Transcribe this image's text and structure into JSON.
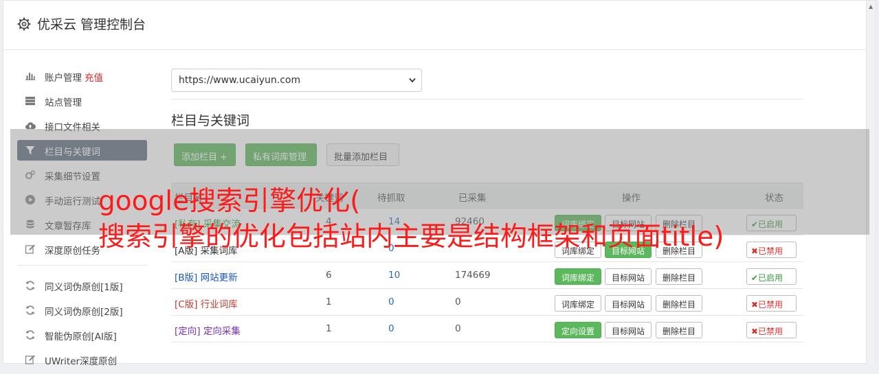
{
  "header": {
    "title": "优采云 管理控制台"
  },
  "sidebar": {
    "items": [
      {
        "label": "账户管理",
        "extra": "充值",
        "icon": "bar-chart-icon"
      },
      {
        "label": "站点管理",
        "icon": "server-icon"
      },
      {
        "label": "接口文件相关",
        "icon": "cloud-upload-icon"
      },
      {
        "label": "栏目与关键词",
        "icon": "filter-icon",
        "active": true
      },
      {
        "label": "采集细节设置",
        "icon": "cogs-icon"
      },
      {
        "label": "手动运行测试",
        "icon": "play-icon"
      },
      {
        "label": "文章暂存库",
        "icon": "database-icon"
      },
      {
        "label": "深度原创任务",
        "icon": "edit-icon"
      }
    ],
    "items2": [
      {
        "label": "同义词伪原创[1版]",
        "icon": "refresh-icon"
      },
      {
        "label": "同义词伪原创[2版]",
        "icon": "refresh-icon"
      },
      {
        "label": "智能伪原创[AI版]",
        "icon": "refresh-icon"
      },
      {
        "label": "UWriter深度原创",
        "icon": "edit-icon"
      }
    ]
  },
  "site_select": {
    "value": "https://www.ucaiyun.com"
  },
  "section": {
    "title": "栏目与关键词"
  },
  "buttons": {
    "add_column": "添加栏目 +",
    "private_lib": "私有词库管理",
    "batch_add": "批量添加栏目"
  },
  "table": {
    "headers": {
      "name": "栏目名",
      "keywords": "关键词",
      "pending": "待抓取",
      "collected": "已采集",
      "ops": "操作",
      "status": "状态"
    },
    "rows": [
      {
        "name": "[私有] 采集交流",
        "color": "#3c9a3c",
        "kw": "4",
        "pending": "14",
        "collected": "92460",
        "op1": "词库绑定",
        "op1_green": true,
        "op2": "目标网站",
        "op2_green": false,
        "op3": "删除栏目",
        "status": "✔已启用",
        "on": true
      },
      {
        "name": "[A版] 采集词库",
        "color": "#333333",
        "kw": "",
        "pending": "0",
        "collected": "",
        "op1": "词库绑定",
        "op1_green": false,
        "op2": "目标网站",
        "op2_green": true,
        "op3": "删除栏目",
        "status": "✖已禁用",
        "on": false
      },
      {
        "name": "[B版] 网站更新",
        "color": "#1a56c4",
        "kw": "6",
        "pending": "10",
        "collected": "174669",
        "op1": "词库绑定",
        "op1_green": true,
        "op2": "目标网站",
        "op2_green": false,
        "op3": "删除栏目",
        "status": "✔已启用",
        "on": true
      },
      {
        "name": "[C版] 行业词库",
        "color": "#c0392b",
        "kw": "1",
        "pending": "0",
        "collected": "0",
        "op1": "词库绑定",
        "op1_green": false,
        "op2": "目标网站",
        "op2_green": false,
        "op3": "删除栏目",
        "status": "✖已禁用",
        "on": false
      },
      {
        "name": "[定向] 定向采集",
        "color": "#7b2fbe",
        "kw": "1",
        "pending": "0",
        "collected": "0",
        "op1": "定向设置",
        "op1_green": true,
        "op2": "目标网站",
        "op2_green": false,
        "op3": "删除栏目",
        "status": "✖已禁用",
        "on": false
      }
    ]
  },
  "overlay_text": {
    "line1": "google搜索引擎优化(",
    "line2": "搜索引擎的优化包括站内主要是结构框架和页面title)"
  }
}
